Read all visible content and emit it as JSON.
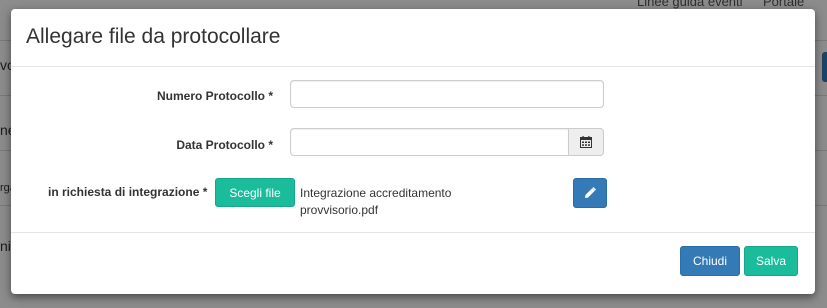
{
  "background": {
    "top_nav": [
      "Linee guida eventi",
      "Portale"
    ],
    "fragments": [
      "vo",
      "ne",
      "rga",
      "ni"
    ]
  },
  "modal": {
    "title": "Allegare file da protocollare",
    "fields": {
      "numero_protocollo": {
        "label": "Numero Protocollo *",
        "value": ""
      },
      "data_protocollo": {
        "label": "Data Protocollo *",
        "value": "",
        "addon_icon": "calendar-icon"
      },
      "richiesta_integrazione": {
        "label": "in richiesta di integrazione *",
        "choose_button": "Scegli file",
        "file_name": "Integrazione accreditamento provvisorio.pdf",
        "edit_icon": "pencil-icon"
      }
    },
    "footer": {
      "close_label": "Chiudi",
      "save_label": "Salva"
    }
  },
  "colors": {
    "primary": "#337ab7",
    "success": "#1abc9c",
    "overlay": "#000000"
  }
}
